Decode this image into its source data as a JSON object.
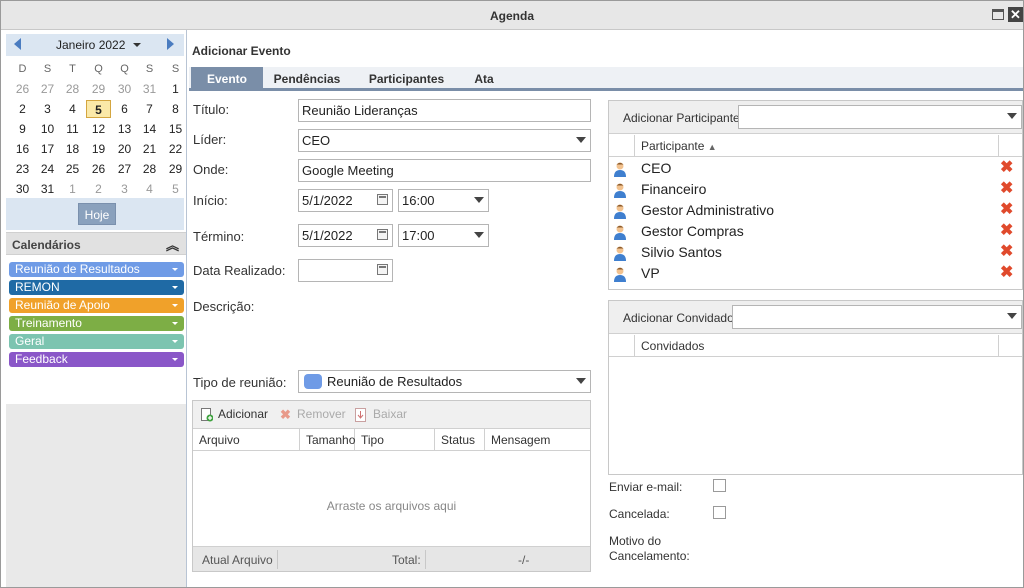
{
  "window": {
    "title": "Agenda"
  },
  "calendar": {
    "month_label": "Janeiro 2022",
    "weekdays": [
      "D",
      "S",
      "T",
      "Q",
      "Q",
      "S",
      "S"
    ],
    "weeks": [
      [
        "26",
        "27",
        "28",
        "29",
        "30",
        "31",
        "1"
      ],
      [
        "2",
        "3",
        "4",
        "5",
        "6",
        "7",
        "8"
      ],
      [
        "9",
        "10",
        "11",
        "12",
        "13",
        "14",
        "15"
      ],
      [
        "16",
        "17",
        "18",
        "19",
        "20",
        "21",
        "22"
      ],
      [
        "23",
        "24",
        "25",
        "26",
        "27",
        "28",
        "29"
      ],
      [
        "30",
        "31",
        "1",
        "2",
        "3",
        "4",
        "5"
      ]
    ],
    "today_label": "Hoje"
  },
  "calendars_section": {
    "title": "Calendários",
    "items": [
      {
        "label": "Reunião de Resultados",
        "color": "#6f9be6"
      },
      {
        "label": "REMON",
        "color": "#1f6aa5"
      },
      {
        "label": "Reunião de Apoio",
        "color": "#f0a12a"
      },
      {
        "label": "Treinamento",
        "color": "#7dae45"
      },
      {
        "label": "Geral",
        "color": "#7cc4b0"
      },
      {
        "label": "Feedback",
        "color": "#8a57c8"
      }
    ]
  },
  "form": {
    "header": "Adicionar Evento",
    "tabs": [
      "Evento",
      "Pendências",
      "Participantes",
      "Ata"
    ],
    "titulo_label": "Título:",
    "titulo_value": "Reunião Lideranças",
    "lider_label": "Líder:",
    "lider_value": "CEO",
    "onde_label": "Onde:",
    "onde_value": "Google Meeting",
    "inicio_label": "Início:",
    "inicio_date": "5/1/2022",
    "inicio_time": "16:00",
    "termino_label": "Término:",
    "termino_date": "5/1/2022",
    "termino_time": "17:00",
    "realizado_label": "Data Realizado:",
    "realizado_value": "",
    "descricao_label": "Descrição:",
    "tipo_label": "Tipo de reunião:",
    "tipo_value": "Reunião de Resultados"
  },
  "files": {
    "add_label": "Adicionar",
    "remove_label": "Remover",
    "download_label": "Baixar",
    "columns": [
      "Arquivo",
      "Tamanho",
      "Tipo",
      "Status",
      "Mensagem"
    ],
    "empty_message": "Arraste os arquivos aqui",
    "footer_current": "Atual Arquivo",
    "footer_total": "Total:",
    "footer_value": "-/-"
  },
  "participants": {
    "add_label": "Adicionar Participante:",
    "column": "Participante",
    "rows": [
      "CEO",
      "Financeiro",
      "Gestor Administrativo",
      "Gestor Compras",
      "Silvio Santos",
      "VP"
    ]
  },
  "guests": {
    "add_label": "Adicionar Convidado:",
    "column": "Convidados"
  },
  "options": {
    "email_label": "Enviar e-mail:",
    "cancelada_label": "Cancelada:",
    "motivo_label_1": "Motivo do",
    "motivo_label_2": "Cancelamento:"
  }
}
